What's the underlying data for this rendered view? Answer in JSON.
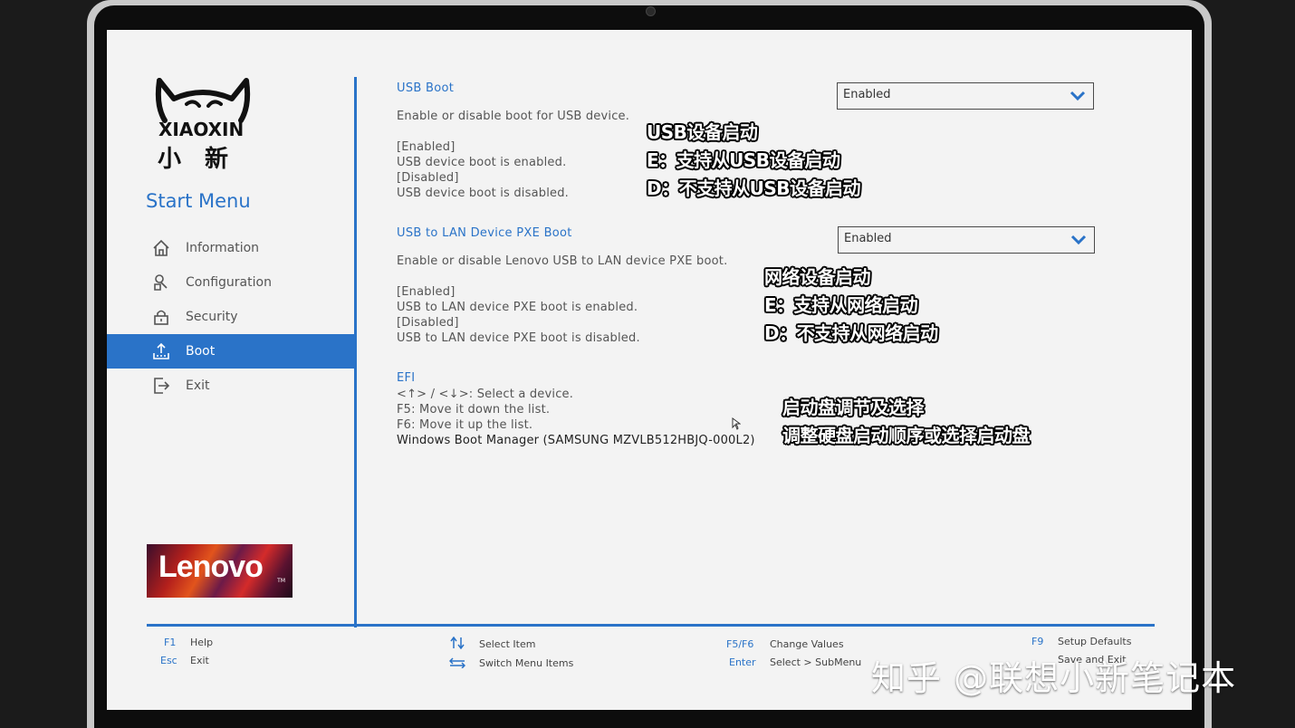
{
  "brand": {
    "logo_text": "XIAOXIN",
    "logo_cn": "小新",
    "lenovo": "Lenovo"
  },
  "sidebar": {
    "title": "Start Menu",
    "items": [
      {
        "label": "Information",
        "icon": "home-icon"
      },
      {
        "label": "Configuration",
        "icon": "configuration-icon"
      },
      {
        "label": "Security",
        "icon": "lock-icon"
      },
      {
        "label": "Boot",
        "icon": "boot-icon",
        "active": true
      },
      {
        "label": "Exit",
        "icon": "exit-icon"
      }
    ]
  },
  "usb_boot": {
    "title": "USB Boot",
    "desc": "Enable or disable boot for USB device.",
    "enabled_tag": "[Enabled]",
    "enabled_desc": "USB device boot is enabled.",
    "disabled_tag": "[Disabled]",
    "disabled_desc": "USB device boot is disabled.",
    "value": "Enabled"
  },
  "pxe_boot": {
    "title": "USB to LAN Device PXE Boot",
    "desc": "Enable or disable Lenovo USB to LAN device PXE boot.",
    "enabled_tag": "[Enabled]",
    "enabled_desc": "USB to LAN device PXE boot is enabled.",
    "disabled_tag": "[Disabled]",
    "disabled_desc": "USB to LAN device PXE boot is disabled.",
    "value": "Enabled"
  },
  "efi": {
    "title": "EFI",
    "line1": "<↑> / <↓>: Select a device.",
    "line2": "F5: Move it down the list.",
    "line3": "F6: Move it up the list.",
    "device": "Windows Boot Manager (SAMSUNG MZVLB512HBJQ-000L2)"
  },
  "annotations": {
    "usb": [
      "USB设备启动",
      "E：支持从USB设备启动",
      "D：不支持从USB设备启动"
    ],
    "pxe": [
      "网络设备启动",
      "E：支持从网络启动",
      "D：不支持从网络启动"
    ],
    "efi": [
      "启动盘调节及选择",
      "调整硬盘启动顺序或选择启动盘"
    ]
  },
  "footer": {
    "f1_key": "F1",
    "f1_desc": "Help",
    "esc_key": "Esc",
    "esc_desc": "Exit",
    "select_item": "Select Item",
    "switch_menu": "Switch Menu Items",
    "f5f6_key": "F5/F6",
    "f5f6_desc": "Change Values",
    "enter_key": "Enter",
    "enter_desc": "Select > SubMenu",
    "f9_key": "F9",
    "f9_desc": "Setup Defaults",
    "f10_desc": "Save and Exit"
  },
  "watermark": "知乎 @联想小新笔记本",
  "colors": {
    "accent": "#2a73c8",
    "screen_bg": "#f3f3f3"
  }
}
